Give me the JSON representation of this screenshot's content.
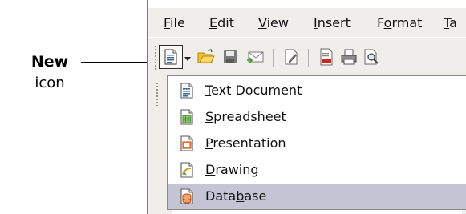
{
  "callout": {
    "title": "New",
    "subtitle": "icon"
  },
  "menubar": {
    "items": [
      {
        "mnemonic": "F",
        "rest": "ile"
      },
      {
        "mnemonic": "E",
        "rest": "dit"
      },
      {
        "mnemonic": "V",
        "rest": "iew"
      },
      {
        "mnemonic": "I",
        "rest": "nsert"
      },
      {
        "pre": "F",
        "mnemonic": "o",
        "rest": "rmat"
      },
      {
        "mnemonic": "T",
        "rest": "a"
      }
    ]
  },
  "toolbar": {
    "icons": [
      "new-icon",
      "dropdown-arrow-icon",
      "open-folder-icon",
      "save-icon",
      "email-icon",
      "edit-file-icon",
      "export-pdf-icon",
      "print-icon",
      "page-preview-icon"
    ]
  },
  "new_menu": {
    "items": [
      {
        "pre": "",
        "mnemonic": "T",
        "rest": "ext Document",
        "icon": "text-document-icon",
        "color": "#3c6a9e"
      },
      {
        "pre": "",
        "mnemonic": "S",
        "rest": "preadsheet",
        "icon": "spreadsheet-icon",
        "color": "#3d8a2a"
      },
      {
        "pre": "",
        "mnemonic": "P",
        "rest": "resentation",
        "icon": "presentation-icon",
        "color": "#d25a1a"
      },
      {
        "pre": "",
        "mnemonic": "D",
        "rest": "rawing",
        "icon": "drawing-icon",
        "color": "#c8a21a"
      },
      {
        "pre": "Data",
        "mnemonic": "b",
        "rest": "ase",
        "icon": "database-icon",
        "color": "#c8461e",
        "selected": true
      }
    ]
  }
}
